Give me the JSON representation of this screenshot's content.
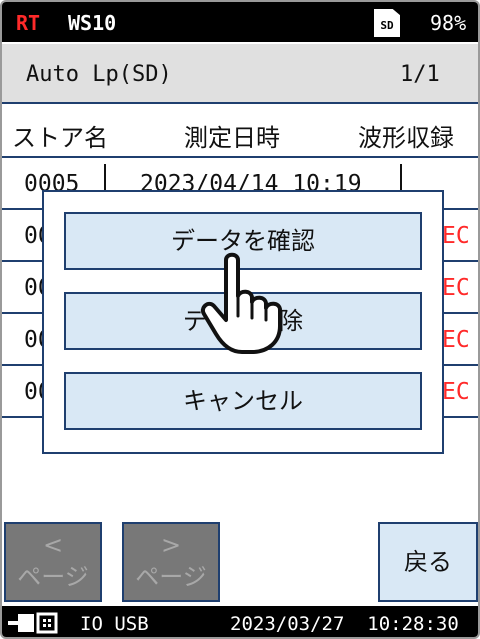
{
  "statusbar": {
    "mode": "RT",
    "station": "WS10",
    "sd_label": "SD",
    "battery": "98%"
  },
  "title": {
    "text": "Auto Lp(SD)",
    "page": "1/1"
  },
  "table": {
    "headers": [
      "ストア名",
      "測定日時",
      "波形収録"
    ],
    "rows": [
      {
        "store": "0005",
        "datetime": "2023/04/14 10:19",
        "rec": ""
      },
      {
        "store": "00",
        "datetime": "",
        "rec": "EC"
      },
      {
        "store": "00",
        "datetime": "",
        "rec": "EC"
      },
      {
        "store": "00",
        "datetime": "",
        "rec": "EC"
      },
      {
        "store": "00",
        "datetime": "",
        "rec": "EC"
      }
    ]
  },
  "dialog": {
    "confirm_label": "データを確認",
    "delete_label": "データ削除",
    "cancel_label": "キャンセル"
  },
  "nav": {
    "prev_arrow": "<",
    "prev_label": "ページ",
    "next_arrow": ">",
    "next_label": "ページ",
    "back_label": "戻る"
  },
  "bottombar": {
    "interface": "IO USB",
    "datetime": "2023/03/27  10:28:30"
  },
  "colors": {
    "accent_border": "#1f3f6f",
    "button_fill": "#d9e8f5",
    "disabled_fill": "#787878",
    "alert_red": "#ff2a2a"
  },
  "icons": {
    "storage": "sd-card-icon",
    "connection": "usb-plug-icon",
    "pointer": "hand-pointer-icon"
  }
}
